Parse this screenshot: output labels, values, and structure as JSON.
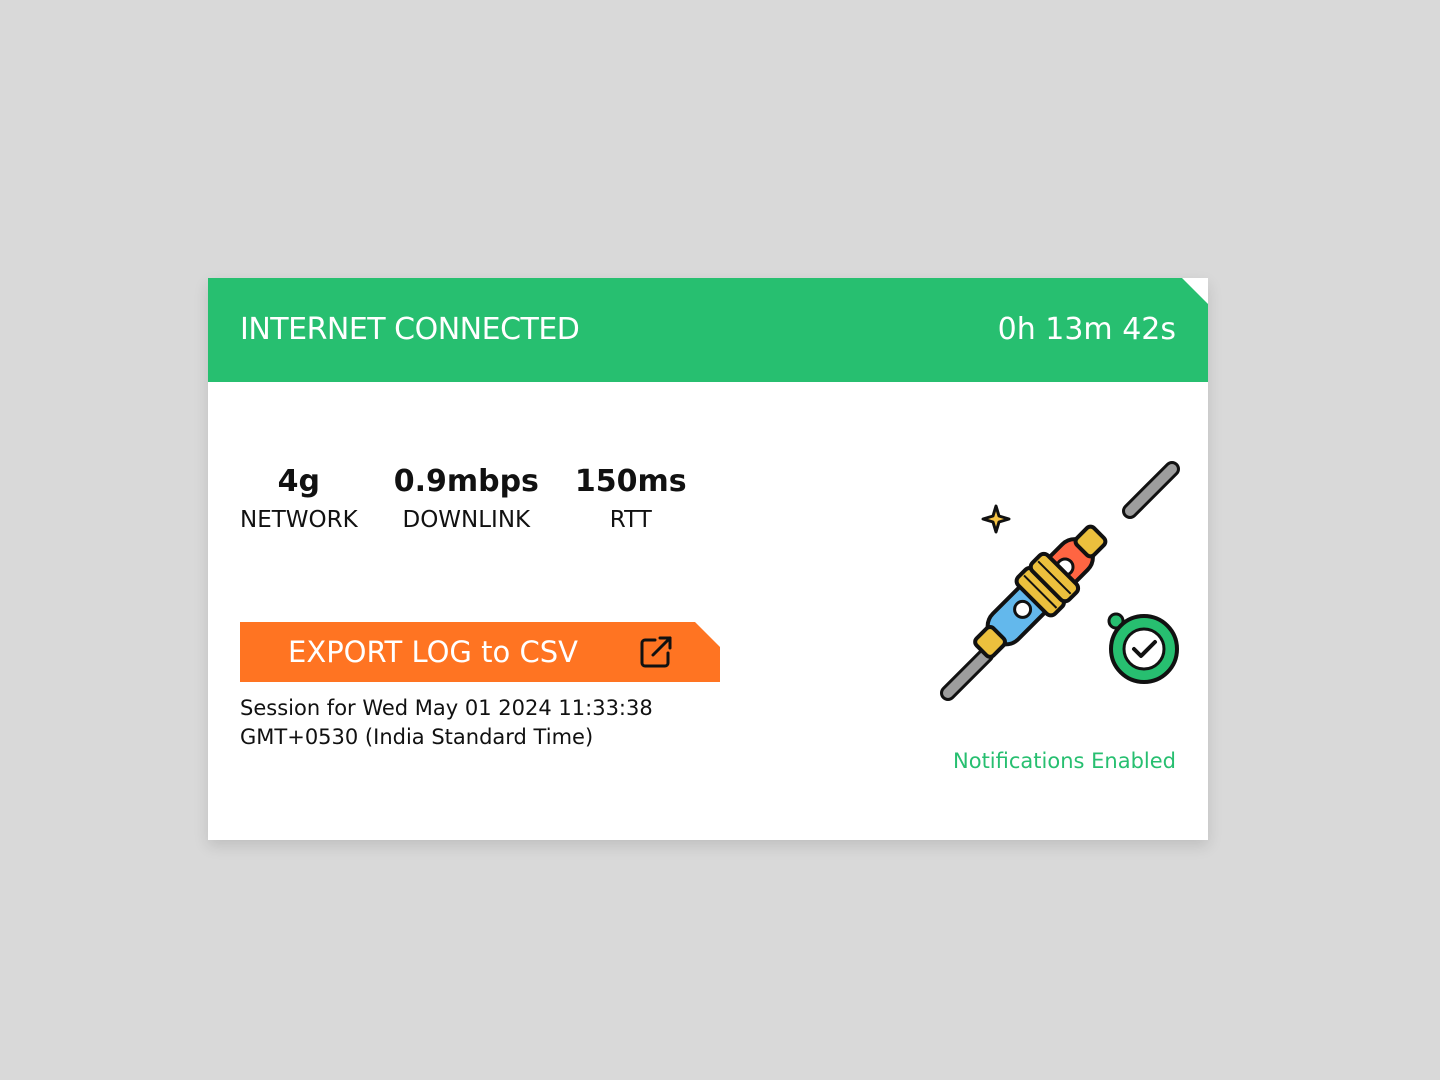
{
  "status": {
    "title": "INTERNET CONNECTED",
    "uptime": "0h 13m 42s"
  },
  "stats": [
    {
      "value": "4g",
      "label": "NETWORK"
    },
    {
      "value": "0.9mbps",
      "label": "DOWNLINK"
    },
    {
      "value": "150ms",
      "label": "RTT"
    }
  ],
  "export_button": {
    "label": "EXPORT LOG to CSV",
    "icon": "external-link-icon"
  },
  "session": {
    "text": "Session for Wed May 01 2024 11:33:38 GMT+0530 (India Standard Time)"
  },
  "illustration": {
    "icon": "plug-connected-icon",
    "badge_icon": "check-circle-icon"
  },
  "notifications": {
    "label": "Notifications Enabled"
  },
  "colors": {
    "background": "#d9d9d9",
    "success": "#27bf70",
    "accent": "#ff7422",
    "card": "#ffffff",
    "text": "#111111"
  }
}
